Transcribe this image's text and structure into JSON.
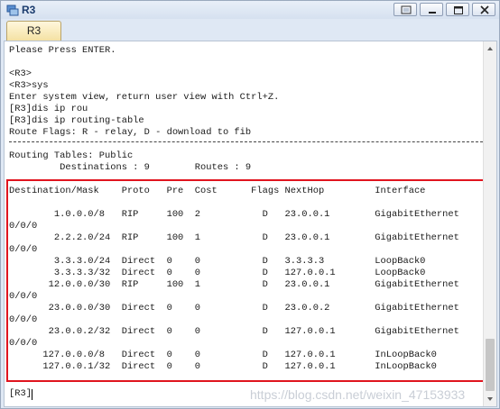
{
  "window": {
    "title": "R3",
    "tab_label": "R3"
  },
  "console": {
    "preamble": [
      "Please Press ENTER.",
      "",
      "<R3>",
      "<R3>sys",
      "Enter system view, return user view with Ctrl+Z.",
      "[R3]dis ip rou",
      "[R3]dis ip routing-table",
      "Route Flags: R - relay, D - download to fib"
    ],
    "routing_tables": "Routing Tables: Public",
    "counts": "         Destinations : 9        Routes : 9",
    "table_header": "Destination/Mask    Proto   Pre  Cost      Flags NextHop         Interface",
    "table_rows": [
      "",
      "        1.0.0.0/8   RIP     100  2           D   23.0.0.1        GigabitEthernet",
      "0/0/0",
      "        2.2.2.0/24  RIP     100  1           D   23.0.0.1        GigabitEthernet",
      "0/0/0",
      "        3.3.3.0/24  Direct  0    0           D   3.3.3.3         LoopBack0",
      "        3.3.3.3/32  Direct  0    0           D   127.0.0.1       LoopBack0",
      "       12.0.0.0/30  RIP     100  1           D   23.0.0.1        GigabitEthernet",
      "0/0/0",
      "       23.0.0.0/30  Direct  0    0           D   23.0.0.2        GigabitEthernet",
      "0/0/0",
      "       23.0.0.2/32  Direct  0    0           D   127.0.0.1       GigabitEthernet",
      "0/0/0",
      "      127.0.0.0/8   Direct  0    0           D   127.0.0.1       InLoopBack0",
      "      127.0.0.1/32  Direct  0    0           D   127.0.0.1       InLoopBack0"
    ],
    "prompt": "[R3]"
  },
  "watermark": "https://blog.csdn.net/weixin_47153933",
  "colors": {
    "highlight_border": "#e0141e",
    "tab_background": "#f4e1a3",
    "title_text": "#1b3c6e"
  },
  "icons": {
    "app": "router-app-icon",
    "restore": "restore-icon",
    "minimize": "minimize-icon",
    "maximize": "maximize-icon",
    "close": "close-icon"
  }
}
